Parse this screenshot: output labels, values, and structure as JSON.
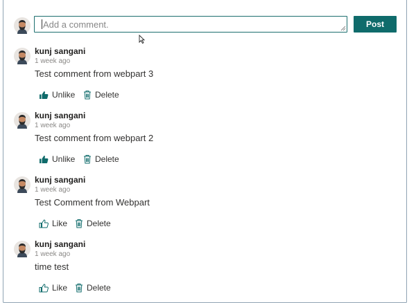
{
  "composer": {
    "placeholder": "Add a comment.",
    "post_label": "Post"
  },
  "comments": [
    {
      "author": "kunj sangani",
      "time": "1 week ago",
      "text": "Test comment from webpart 3",
      "like_label": "Unlike",
      "liked": true,
      "delete_label": "Delete"
    },
    {
      "author": "kunj sangani",
      "time": "1 week ago",
      "text": "Test comment from webpart 2",
      "like_label": "Unlike",
      "liked": true,
      "delete_label": "Delete"
    },
    {
      "author": "kunj sangani",
      "time": "1 week ago",
      "text": "Test Comment from Webpart",
      "like_label": "Like",
      "liked": false,
      "delete_label": "Delete"
    },
    {
      "author": "kunj sangani",
      "time": "1 week ago",
      "text": "time test",
      "like_label": "Like",
      "liked": false,
      "delete_label": "Delete"
    }
  ],
  "colors": {
    "accent": "#0f6b6b",
    "input_border": "#1b6e6e"
  },
  "icons": {
    "avatar": "user-avatar-icon",
    "liked": "thumbs-up-filled-icon",
    "unliked": "thumbs-up-outline-icon",
    "delete": "trash-icon"
  }
}
